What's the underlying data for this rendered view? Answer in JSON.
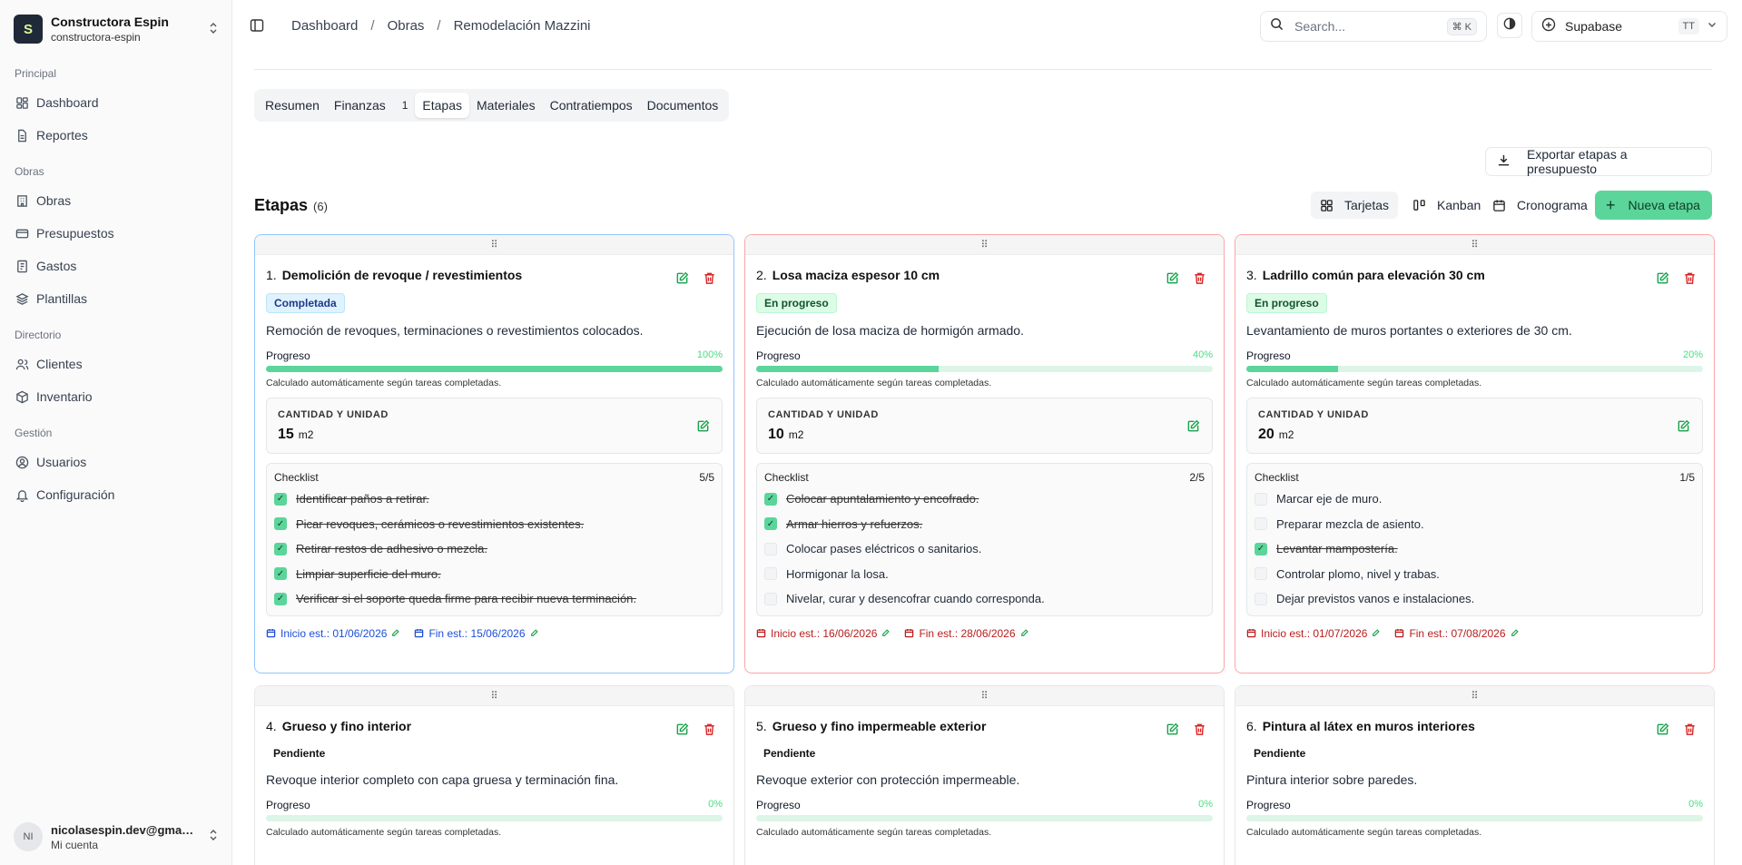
{
  "org": {
    "logo": "S",
    "name": "Constructora Espin",
    "slug": "constructora-espin"
  },
  "nav": {
    "groups": [
      "Principal",
      "Obras",
      "Directorio",
      "Gestión"
    ],
    "items": [
      "Dashboard",
      "Reportes",
      "Obras",
      "Presupuestos",
      "Gastos",
      "Plantillas",
      "Clientes",
      "Inventario",
      "Usuarios",
      "Configuración"
    ]
  },
  "user": {
    "initials": "NI",
    "email": "nicolasespin.dev@gmail.com",
    "sub": "Mi cuenta"
  },
  "breadcrumb": [
    "Dashboard",
    "Obras",
    "Remodelación Mazzini"
  ],
  "search": {
    "placeholder": "Search...",
    "shortcut": "⌘ K"
  },
  "account": {
    "name": "Supabase",
    "initials": "TT"
  },
  "tabs": [
    {
      "label": "Resumen"
    },
    {
      "label": "Finanzas",
      "count": "1"
    },
    {
      "label": "Etapas"
    },
    {
      "label": "Materiales"
    },
    {
      "label": "Contratiempos"
    },
    {
      "label": "Documentos"
    }
  ],
  "export_label": "Exportar etapas a presupuesto",
  "section": {
    "title": "Etapas",
    "count": "(6)"
  },
  "views": {
    "cards": "Tarjetas",
    "kanban": "Kanban",
    "schedule": "Cronograma"
  },
  "new_label": "Nueva etapa",
  "card_labels": {
    "progress": "Progreso",
    "calc": "Calculado automáticamente según tareas completadas.",
    "qty": "CANTIDAD Y UNIDAD",
    "checklist": "Checklist",
    "start_prefix": "Inicio est.:",
    "end_prefix": "Fin est.:"
  },
  "stages": [
    {
      "index": "1.",
      "title": "Demolición de revoque / revestimientos",
      "status": "Completada",
      "description": "Remoción de revoques, terminaciones o revestimientos colocados.",
      "progress": 100,
      "progress_label": "100%",
      "qty": "15",
      "unit": "m2",
      "check_count": "5/5",
      "checklist": [
        {
          "text": "Identificar paños a retirar.",
          "done": true
        },
        {
          "text": "Picar revoques, cerámicos o revestimientos existentes.",
          "done": true
        },
        {
          "text": "Retirar restos de adhesivo o mezcla.",
          "done": true
        },
        {
          "text": "Limpiar superficie del muro.",
          "done": true
        },
        {
          "text": "Verificar si el soporte queda firme para recibir nueva terminación.",
          "done": true
        }
      ],
      "start": "01/06/2026",
      "end": "15/06/2026"
    },
    {
      "index": "2.",
      "title": "Losa maciza espesor 10 cm",
      "status": "En progreso",
      "description": "Ejecución de losa maciza de hormigón armado.",
      "progress": 40,
      "progress_label": "40%",
      "qty": "10",
      "unit": "m2",
      "check_count": "2/5",
      "checklist": [
        {
          "text": "Colocar apuntalamiento y encofrado.",
          "done": true
        },
        {
          "text": "Armar hierros y refuerzos.",
          "done": true
        },
        {
          "text": "Colocar pases eléctricos o sanitarios.",
          "done": false
        },
        {
          "text": "Hormigonar la losa.",
          "done": false
        },
        {
          "text": "Nivelar, curar y desencofrar cuando corresponda.",
          "done": false
        }
      ],
      "start": "16/06/2026",
      "end": "28/06/2026"
    },
    {
      "index": "3.",
      "title": "Ladrillo común para elevación 30 cm",
      "status": "En progreso",
      "description": "Levantamiento de muros portantes o exteriores de 30 cm.",
      "progress": 20,
      "progress_label": "20%",
      "qty": "20",
      "unit": "m2",
      "check_count": "1/5",
      "checklist": [
        {
          "text": "Marcar eje de muro.",
          "done": false
        },
        {
          "text": "Preparar mezcla de asiento.",
          "done": false
        },
        {
          "text": "Levantar mampostería.",
          "done": true
        },
        {
          "text": "Controlar plomo, nivel y trabas.",
          "done": false
        },
        {
          "text": "Dejar previstos vanos e instalaciones.",
          "done": false
        }
      ],
      "start": "01/07/2026",
      "end": "07/08/2026"
    },
    {
      "index": "4.",
      "title": "Grueso y fino interior",
      "status": "Pendiente",
      "description": "Revoque interior completo con capa gruesa y terminación fina.",
      "progress": 0,
      "progress_label": "0%"
    },
    {
      "index": "5.",
      "title": "Grueso y fino impermeable exterior",
      "status": "Pendiente",
      "description": "Revoque exterior con protección impermeable.",
      "progress": 0,
      "progress_label": "0%"
    },
    {
      "index": "6.",
      "title": "Pintura al látex en muros interiores",
      "status": "Pendiente",
      "description": "Pintura interior sobre paredes.",
      "progress": 0,
      "progress_label": "0%"
    }
  ],
  "colors": {
    "accent": "#5bd59a",
    "completed_border": "#93c5fd",
    "progress_border": "#fca5a5",
    "delete": "#dc2626",
    "edit": "#16a34a"
  }
}
